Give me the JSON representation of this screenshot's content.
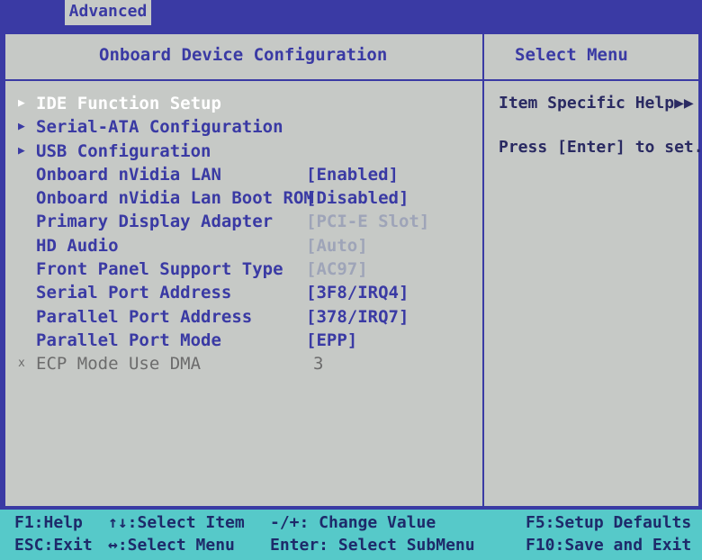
{
  "tabs": {
    "active_tab": "Advanced"
  },
  "header": {
    "left_title": "Onboard Device Configuration",
    "right_title": "Select Menu"
  },
  "menu": {
    "items": [
      {
        "label": "IDE Function Setup",
        "value": "",
        "submenu": true,
        "selected": true
      },
      {
        "label": "Serial-ATA Configuration",
        "value": "",
        "submenu": true
      },
      {
        "label": "USB Configuration",
        "value": "",
        "submenu": true
      },
      {
        "label": "Onboard nVidia LAN",
        "value": "[Enabled]"
      },
      {
        "label": "Onboard nVidia Lan Boot ROM",
        "value": "[Disabled]"
      },
      {
        "label": "Primary Display Adapter",
        "value": "[PCI-E Slot]"
      },
      {
        "label": "HD Audio",
        "value": "[Auto]"
      },
      {
        "label": "Front Panel Support Type",
        "value": "[AC97]"
      },
      {
        "label": "Serial Port Address",
        "value": "[3F8/IRQ4]"
      },
      {
        "label": "Parallel Port Address",
        "value": "[378/IRQ7]"
      },
      {
        "label": "Parallel Port Mode",
        "value": "[EPP]"
      },
      {
        "label": "ECP Mode Use DMA",
        "value": "3",
        "marker": "x"
      }
    ]
  },
  "help": {
    "line1": "Item Specific Help▶▶",
    "line2": "Press [Enter] to set."
  },
  "footer": {
    "f1": "F1:Help",
    "esc": "ESC:Exit",
    "select_item": "↑↓:Select Item",
    "select_menu": "↔:Select Menu",
    "change_value": "-/+: Change Value",
    "enter": "Enter: Select SubMenu",
    "f5": "F5:Setup Defaults",
    "f10": "F10:Save and Exit"
  },
  "colors": {
    "background": "#3a3aa4",
    "panel": "#c6c9c6",
    "footer": "#56c9c9",
    "text": "#3a3aa4",
    "selected": "#ffffff"
  }
}
